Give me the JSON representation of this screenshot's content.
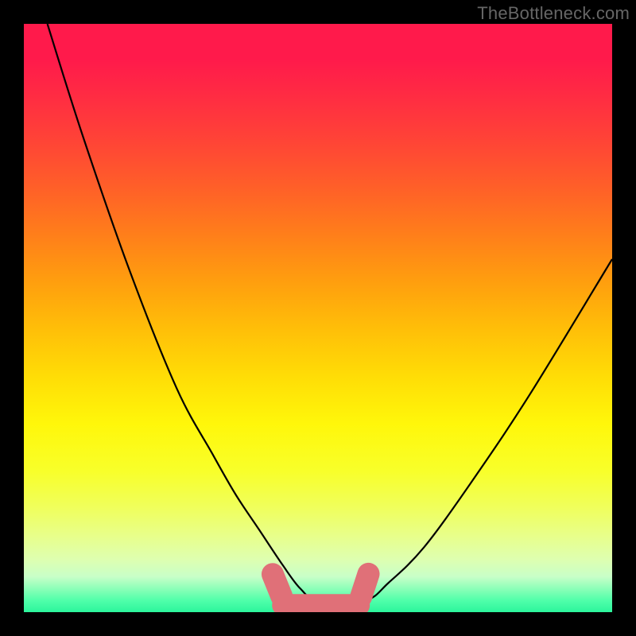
{
  "watermark": "TheBottleneck.com",
  "chart_data": {
    "type": "line",
    "title": "",
    "xlabel": "",
    "ylabel": "",
    "xlim": [
      0,
      100
    ],
    "ylim": [
      0,
      100
    ],
    "grid": false,
    "legend": false,
    "series": [
      {
        "name": "curve",
        "x": [
          4,
          10,
          18,
          26,
          32,
          36,
          40,
          44,
          47,
          50,
          58,
          62,
          68,
          76,
          86,
          100
        ],
        "values": [
          100,
          81,
          58,
          38,
          27,
          20,
          14,
          8,
          4,
          2,
          2,
          5,
          11,
          22,
          37,
          60
        ]
      }
    ],
    "annotations": [
      {
        "name": "valley-marker",
        "color": "#e07078",
        "x_range": [
          43,
          58
        ],
        "y": 2
      }
    ],
    "background": "rainbow-gradient-red-top-green-bottom"
  },
  "colors": {
    "frame": "#000000",
    "curve": "#000000",
    "marker": "#e07078",
    "watermark": "#666666"
  }
}
